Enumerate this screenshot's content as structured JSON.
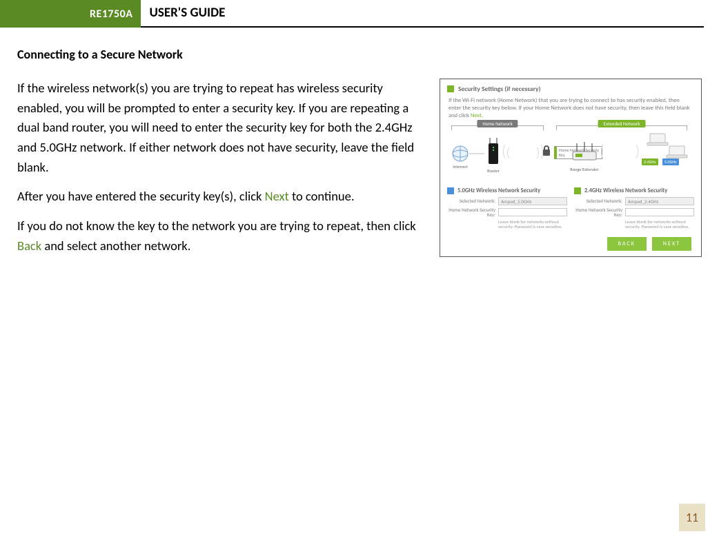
{
  "header": {
    "model": "RE1750A",
    "guide_title": "USER'S GUIDE"
  },
  "section": {
    "heading": "Connecting to a Secure Network",
    "p1": "If the wireless network(s) you are trying to repeat has wireless security enabled, you will be prompted to enter a security key. If you are repeating a dual band router, you will need to enter the security key for both the 2.4GHz and 5.0GHz network. If either network does not have security, leave the field blank.",
    "p2a": "After you have entered the security key(s), click ",
    "p2_link": "Next",
    "p2b": " to continue.",
    "p3a": "If you do not know the key to the network you are trying to repeat, then click ",
    "p3_link": "Back",
    "p3b": " and select another network."
  },
  "figure": {
    "title": "Security Settings (if necessary)",
    "intro_a": "If the Wi-Fi network (Home Network) that you are trying to connect to has security enabled, then enter the security key below. If your Home Network does not have security, then leave this field blank and click ",
    "intro_link": "Next",
    "intro_b": ".",
    "bracket_home": "Home Network",
    "bracket_ext": "Extended Network",
    "dev_internet": "Internet",
    "dev_router": "Router",
    "dev_extender": "Range Extender",
    "key_callout": "Home Network Security Key",
    "band_24": "2.4GHz",
    "band_50": "5.0GHz",
    "sec5_head": "5.0GHz Wireless Network Security",
    "sec24_head": "2.4GHz Wireless Network Security",
    "lbl_selected": "Selected Network:",
    "lbl_key": "Home Network Security Key:",
    "val_sel5": "Amped_5.0GHz",
    "val_sel24": "Amped_2.4GHz",
    "note": "Leave blank for networks without security. Password is case sensitive.",
    "btn_back": "BACK",
    "btn_next": "NEXT"
  },
  "page_number": "11"
}
